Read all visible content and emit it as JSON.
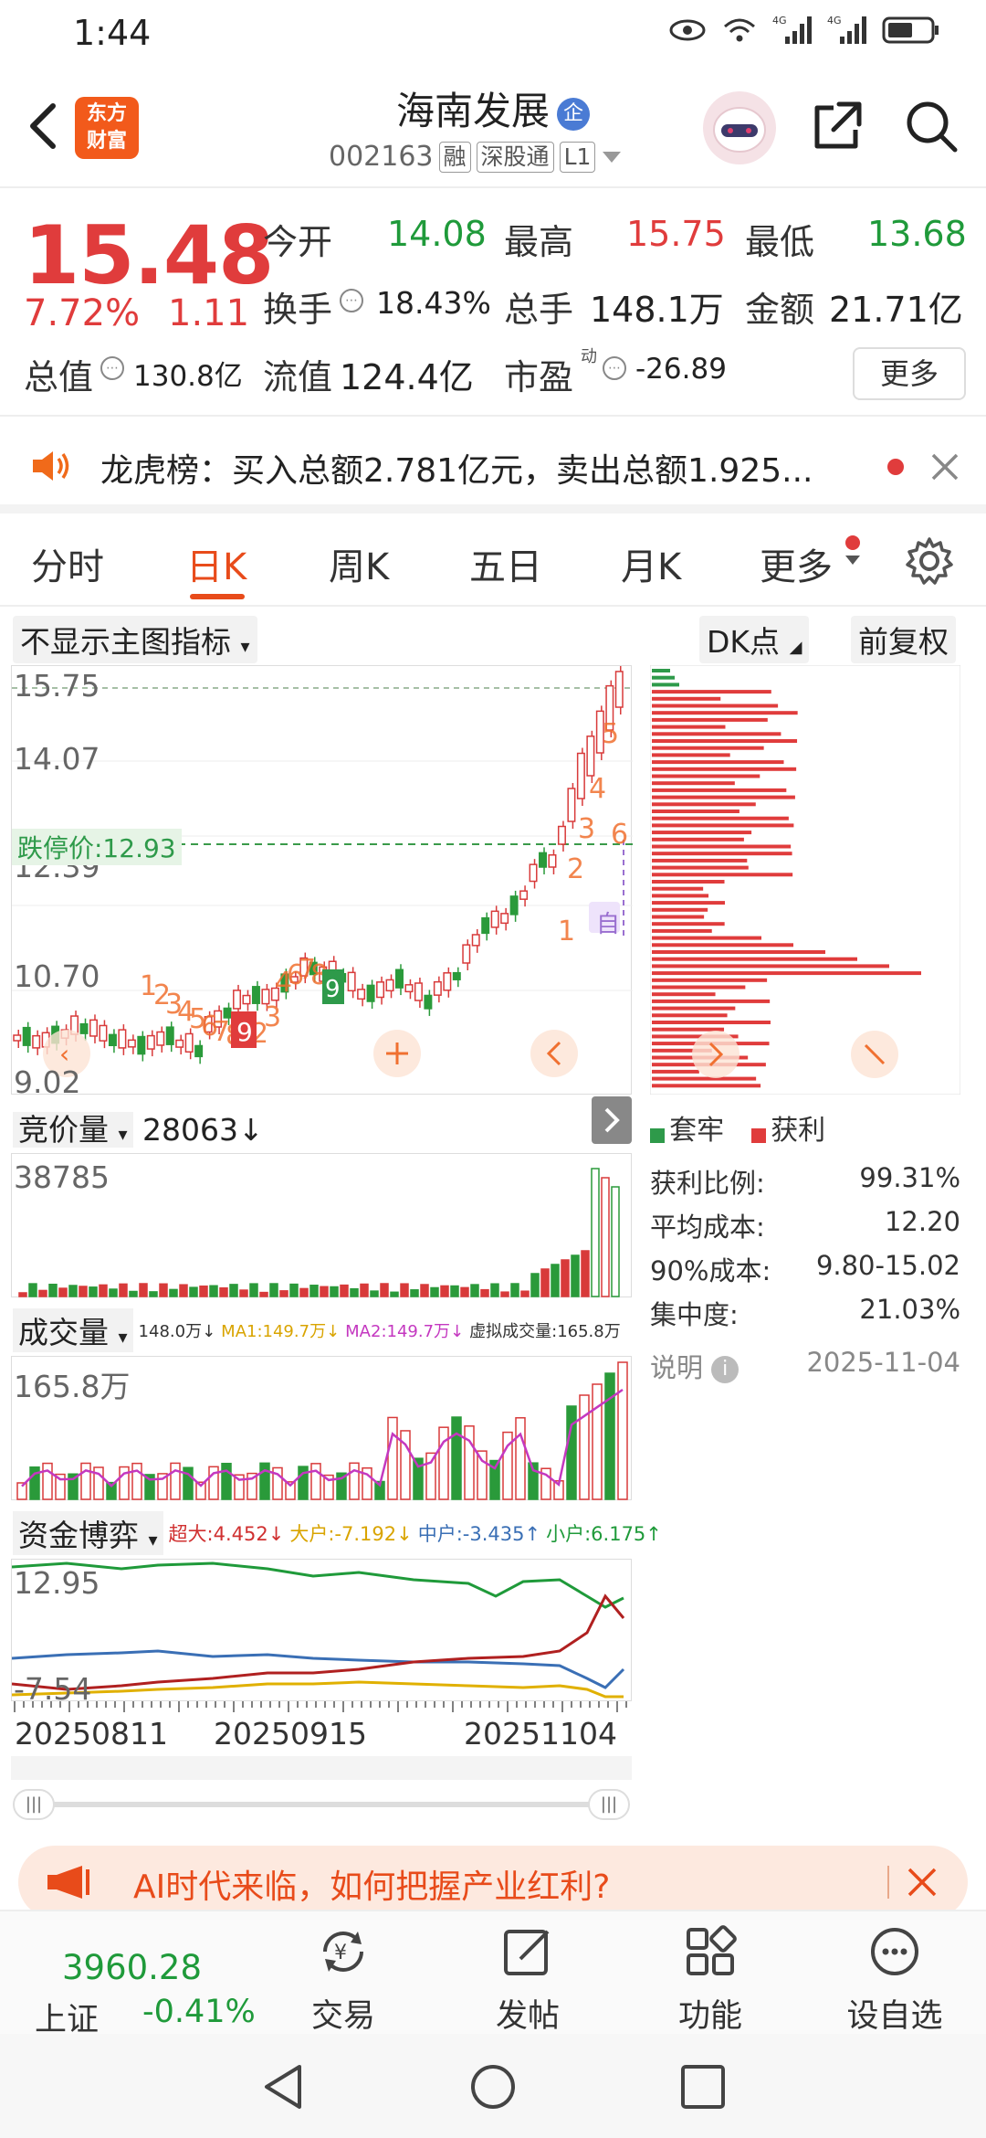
{
  "status_bar": {
    "time": "1:44",
    "net1": "4G",
    "net2": "4G"
  },
  "header": {
    "logo_line1": "东方",
    "logo_line2": "财富",
    "stock_name": "海南发展",
    "corp_badge": "企",
    "code": "002163",
    "tags": [
      "融",
      "深股通",
      "L1"
    ]
  },
  "quote": {
    "price": "15.48",
    "change_pct": "7.72%",
    "change": "1.11",
    "fields": [
      {
        "label": "今开",
        "value": "14.08",
        "color": "#1f9a3a"
      },
      {
        "label": "最高",
        "value": "15.75",
        "color": "#e03c3c"
      },
      {
        "label": "最低",
        "value": "13.68",
        "color": "#1f9a3a"
      },
      {
        "label": "换手",
        "value": "18.43%",
        "color": "#222222"
      },
      {
        "label": "总手",
        "value": "148.1万",
        "color": "#222222"
      },
      {
        "label": "金额",
        "value": "21.71亿",
        "color": "#222222"
      },
      {
        "label": "总值",
        "value": "130.8亿",
        "color": "#222222"
      },
      {
        "label": "流值",
        "value": "124.4亿",
        "color": "#222222"
      },
      {
        "label": "市盈",
        "value": "-26.89",
        "color": "#222222"
      }
    ],
    "pe_sup": "动",
    "more_label": "更多"
  },
  "news": {
    "text": "龙虎榜：买入总额2.781亿元，卖出总额1.925..."
  },
  "tabs": [
    "分时",
    "日K",
    "周K",
    "五日",
    "月K",
    "更多"
  ],
  "chart": {
    "indicator_select": "不显示主图指标",
    "dk_label": "DK点",
    "adjust_label": "前复权",
    "y_labels": [
      "15.75",
      "14.07",
      "12.39",
      "10.70",
      "9.02"
    ],
    "limit_down_label": "跌停价:12.93",
    "auto_label": "自",
    "chip_legend": {
      "trapped": "套牢",
      "profit": "获利"
    },
    "chip_stats": [
      {
        "label": "获利比例:",
        "value": "99.31%"
      },
      {
        "label": "平均成本:",
        "value": "12.20"
      },
      {
        "label": "90%成本:",
        "value": "9.80-15.02"
      },
      {
        "label": "集中度:",
        "value": "21.03%"
      }
    ],
    "explain_label": "说明",
    "date": "2025-11-04",
    "auction_label": "竞价量",
    "auction_value": "28063",
    "auction_y": "38785",
    "volume_label": "成交量",
    "volume_info": [
      {
        "text": "148.0万↓",
        "color": "#333333"
      },
      {
        "text": "MA1:149.7万↓",
        "color": "#d9a400"
      },
      {
        "text": "MA2:149.7万↓",
        "color": "#c438c0"
      },
      {
        "text": "虚拟成交量:165.8万",
        "color": "#333333"
      }
    ],
    "volume_y": "165.8万",
    "fund_label": "资金博弈",
    "fund_info": [
      {
        "text": "超大:4.452↓",
        "color": "#d03030"
      },
      {
        "text": "大户:-7.192↓",
        "color": "#d9a400"
      },
      {
        "text": "中户:-3.435↑",
        "color": "#3a6fb5"
      },
      {
        "text": "小户:6.175↑",
        "color": "#1f9a3a"
      }
    ],
    "fund_y_top": "12.95",
    "fund_y_bottom": "-7.54",
    "x_labels": [
      "20250811",
      "20250915",
      "20251104"
    ]
  },
  "ad": {
    "text": "AI时代来临，如何把握产业红利?"
  },
  "bottom_nav": {
    "index_value": "3960.28",
    "index_name": "上证",
    "index_change": "-0.41%",
    "items": [
      "交易",
      "发帖",
      "功能",
      "设自选"
    ]
  }
}
